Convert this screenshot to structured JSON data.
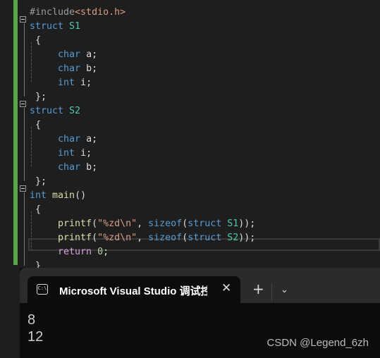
{
  "colors": {
    "keyword": "#569cd6",
    "type_name": "#4ec9b0",
    "string": "#d69d85",
    "function": "#dcdcaa",
    "control": "#d8a0df",
    "number": "#b5cea8",
    "preprocessor": "#9b9b9b",
    "text": "#dcdcdc",
    "change_bar": "#57a64a"
  },
  "code": [
    [
      [
        "preprocessor",
        "#include"
      ],
      [
        "string",
        "<stdio.h>"
      ]
    ],
    [
      [
        "keyword",
        "struct "
      ],
      [
        "type_name",
        "S1"
      ]
    ],
    [
      [
        "text",
        " {"
      ]
    ],
    [
      [
        "keyword",
        "     char "
      ],
      [
        "text",
        "a;"
      ]
    ],
    [
      [
        "keyword",
        "     char "
      ],
      [
        "text",
        "b;"
      ]
    ],
    [
      [
        "keyword",
        "     int "
      ],
      [
        "text",
        "i;"
      ]
    ],
    [
      [
        "text",
        " };"
      ]
    ],
    [
      [
        "keyword",
        "struct "
      ],
      [
        "type_name",
        "S2"
      ]
    ],
    [
      [
        "text",
        " {"
      ]
    ],
    [
      [
        "keyword",
        "     char "
      ],
      [
        "text",
        "a;"
      ]
    ],
    [
      [
        "keyword",
        "     int "
      ],
      [
        "text",
        "i;"
      ]
    ],
    [
      [
        "keyword",
        "     char "
      ],
      [
        "text",
        "b;"
      ]
    ],
    [
      [
        "text",
        " };"
      ]
    ],
    [
      [
        "keyword",
        "int "
      ],
      [
        "function",
        "main"
      ],
      [
        "text",
        "()"
      ]
    ],
    [
      [
        "text",
        " {"
      ]
    ],
    [
      [
        "function",
        "     printf"
      ],
      [
        "text",
        "("
      ],
      [
        "string",
        "\"%zd\\n\""
      ],
      [
        "text",
        ", "
      ],
      [
        "keyword",
        "sizeof"
      ],
      [
        "text",
        "("
      ],
      [
        "keyword",
        "struct "
      ],
      [
        "type_name",
        "S1"
      ],
      [
        "text",
        "));"
      ]
    ],
    [
      [
        "function",
        "     printf"
      ],
      [
        "text",
        "("
      ],
      [
        "string",
        "\"%zd\\n\""
      ],
      [
        "text",
        ", "
      ],
      [
        "keyword",
        "sizeof"
      ],
      [
        "text",
        "("
      ],
      [
        "keyword",
        "struct "
      ],
      [
        "type_name",
        "S2"
      ],
      [
        "text",
        "));"
      ]
    ],
    [
      [
        "control",
        "     return "
      ],
      [
        "number",
        "0"
      ],
      [
        "text",
        ";"
      ]
    ],
    [
      [
        "text",
        " }"
      ]
    ]
  ],
  "terminal": {
    "tab_title": "Microsoft Visual Studio 调试控制台",
    "tab_icon_text": "C:\\",
    "close_glyph": "✕",
    "new_tab_glyph": "+",
    "dropdown_glyph": "⌄",
    "output": [
      "8",
      "12"
    ]
  },
  "watermark": "CSDN @Legend_6zh"
}
